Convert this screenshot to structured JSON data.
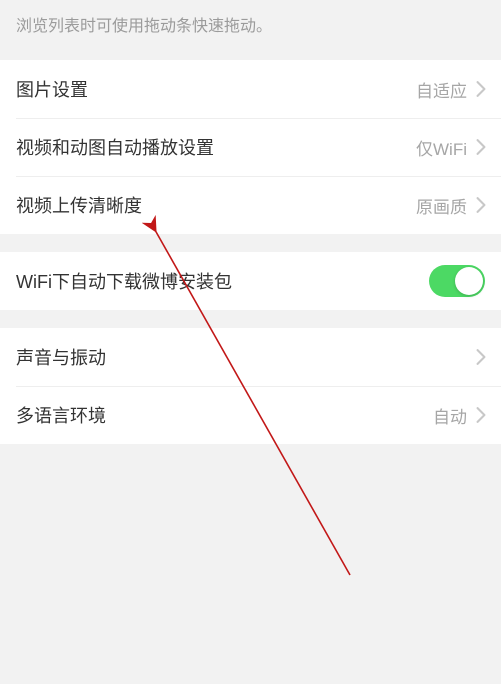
{
  "tip": "浏览列表时可使用拖动条快速拖动。",
  "group1": {
    "image_settings": {
      "label": "图片设置",
      "value": "自适应"
    },
    "video_autoplay": {
      "label": "视频和动图自动播放设置",
      "value": "仅WiFi"
    },
    "video_upload_quality": {
      "label": "视频上传清晰度",
      "value": "原画质"
    }
  },
  "group2": {
    "wifi_auto_download": {
      "label": "WiFi下自动下载微博安装包",
      "on": true
    }
  },
  "group3": {
    "sound_vibration": {
      "label": "声音与振动",
      "value": ""
    },
    "multi_language": {
      "label": "多语言环境",
      "value": "自动"
    }
  }
}
